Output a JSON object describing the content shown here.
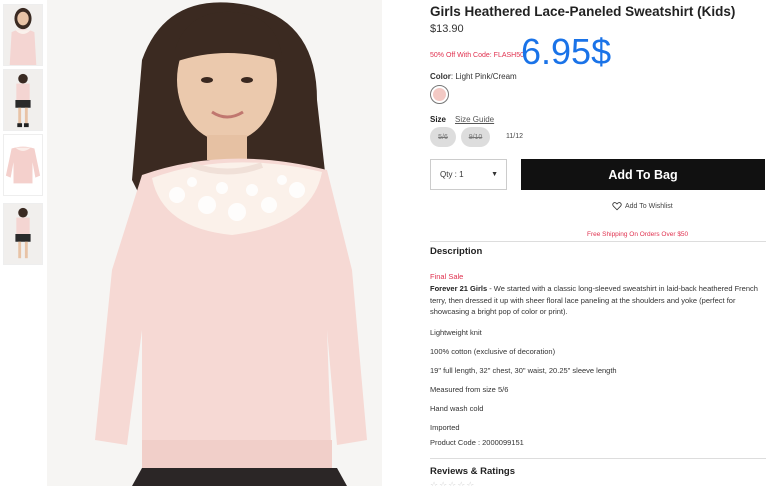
{
  "product": {
    "title": "Girls Heathered Lace-Paneled Sweatshirt (Kids)",
    "price": "$13.90",
    "promo": "50% Off With Code: FLASH50",
    "overlay_price": "6.95$",
    "color_label": "Color",
    "color_value": ": Light Pink/Cream",
    "swatch_color": "#f3c9c4",
    "size_label": "Size",
    "size_guide": "Size Guide",
    "sizes": [
      "5/6",
      "9/10"
    ],
    "size_current": "11/12",
    "qty_label": "Qty : 1",
    "add_to_bag": "Add To Bag",
    "wishlist": "Add To Wishlist",
    "free_shipping": "Free Shipping On Orders Over $50"
  },
  "description": {
    "heading": "Description",
    "final_sale": "Final Sale",
    "brand": "Forever 21 Girls",
    "body": " - We started with a classic long-sleeved sweatshirt in laid-back heathered French terry, then dressed it up with sheer floral lace paneling at the shoulders and yoke (perfect for showcasing a bright pop of color or print).",
    "details": [
      "Lightweight knit",
      "100% cotton (exclusive of decoration)",
      "19\" full length, 32\" chest, 30\" waist, 20.25\" sleeve length",
      "Measured from size 5/6",
      "Hand wash cold",
      "Imported",
      "Product Code : 2000099151"
    ]
  },
  "reviews": {
    "heading": "Reviews & Ratings",
    "stars": "☆☆☆☆☆"
  },
  "colors": {
    "accent_red": "#e0314f",
    "overlay_blue": "#1a73e8",
    "button_black": "#111111"
  }
}
